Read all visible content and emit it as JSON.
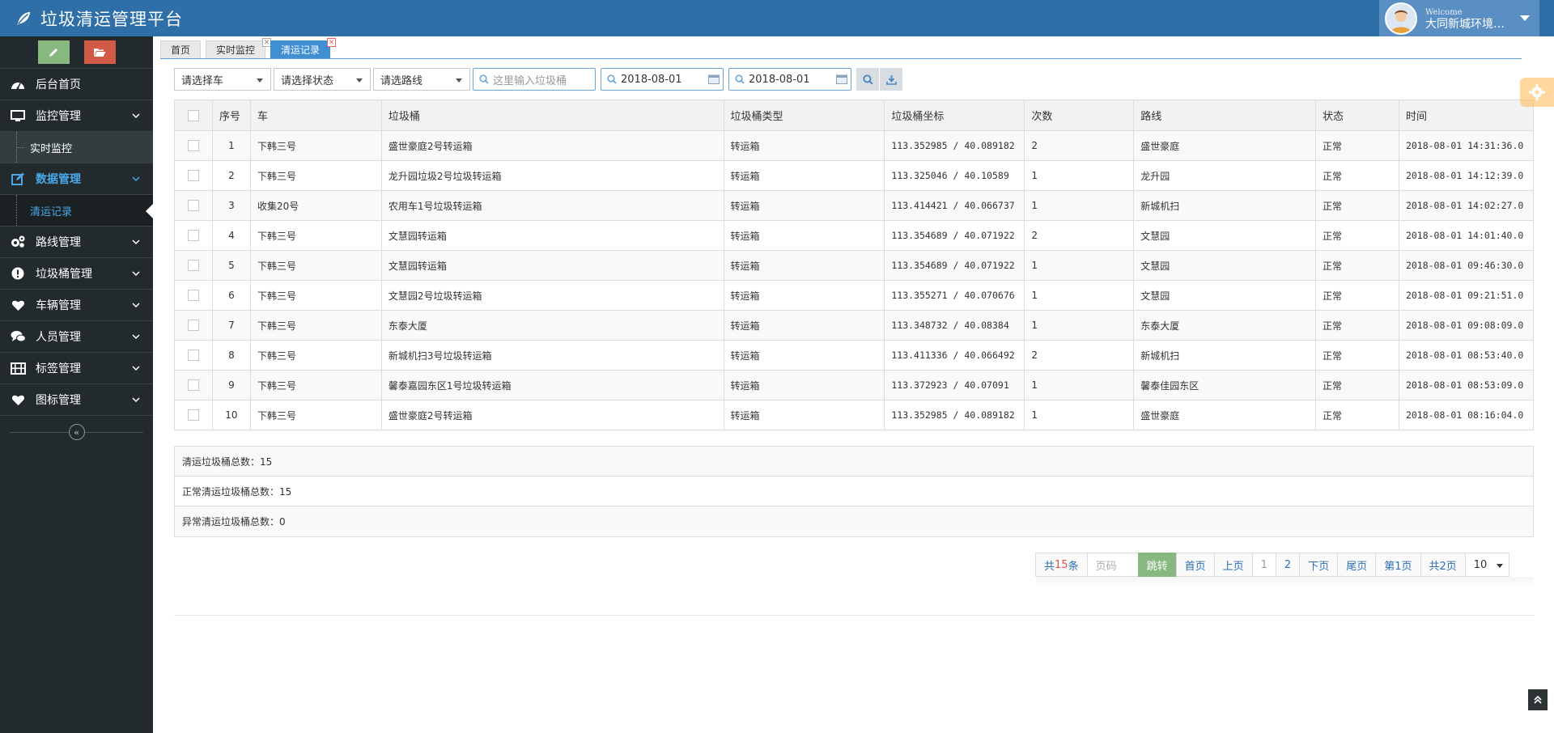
{
  "app": {
    "title": "垃圾清运管理平台",
    "welcome": "Welcome",
    "user": "大同新城环境…",
    "accent": "#2e6fa7"
  },
  "sidebar": {
    "items": [
      {
        "label": "后台首页",
        "icon": "dashboard-icon"
      },
      {
        "label": "监控管理",
        "icon": "desktop-icon"
      },
      {
        "label": "实时监控",
        "icon": ""
      },
      {
        "label": "数据管理",
        "icon": "edit-icon"
      },
      {
        "label": "清运记录",
        "icon": ""
      },
      {
        "label": "路线管理",
        "icon": "cogs-icon"
      },
      {
        "label": "垃圾桶管理",
        "icon": "exclamation-icon"
      },
      {
        "label": "车辆管理",
        "icon": "heart-icon"
      },
      {
        "label": "人员管理",
        "icon": "comments-icon"
      },
      {
        "label": "标签管理",
        "icon": "film-icon"
      },
      {
        "label": "图标管理",
        "icon": "heart-icon"
      }
    ],
    "collapse": "«"
  },
  "tabs": [
    {
      "label": "首页"
    },
    {
      "label": "实时监控"
    },
    {
      "label": "清运记录"
    }
  ],
  "filters": {
    "vehicle": "请选择车",
    "status": "请选择状态",
    "route": "请选路线",
    "bin_placeholder": "这里输入垃圾桶",
    "date_from": "2018-08-01",
    "date_to": "2018-08-01"
  },
  "table": {
    "headers": [
      "序号",
      "车",
      "垃圾桶",
      "垃圾桶类型",
      "垃圾桶坐标",
      "次数",
      "路线",
      "状态",
      "时间"
    ],
    "rows": [
      [
        "1",
        "下韩三号",
        "盛世豪庭2号转运箱",
        "转运箱",
        "113.352985  /  40.089182",
        "2",
        "盛世豪庭",
        "正常",
        "2018-08-01 14:31:36.0"
      ],
      [
        "2",
        "下韩三号",
        "龙升园垃圾2号垃圾转运箱",
        "转运箱",
        "113.325046  /  40.10589",
        "1",
        "龙升园",
        "正常",
        "2018-08-01 14:12:39.0"
      ],
      [
        "3",
        "收集20号",
        "农用车1号垃圾转运箱",
        "转运箱",
        "113.414421  /  40.066737",
        "1",
        "新城机扫",
        "正常",
        "2018-08-01 14:02:27.0"
      ],
      [
        "4",
        "下韩三号",
        "文慧园转运箱",
        "转运箱",
        "113.354689  /  40.071922",
        "2",
        "文慧园",
        "正常",
        "2018-08-01 14:01:40.0"
      ],
      [
        "5",
        "下韩三号",
        "文慧园转运箱",
        "转运箱",
        "113.354689  /  40.071922",
        "1",
        "文慧园",
        "正常",
        "2018-08-01 09:46:30.0"
      ],
      [
        "6",
        "下韩三号",
        "文慧园2号垃圾转运箱",
        "转运箱",
        "113.355271  /  40.070676",
        "1",
        "文慧园",
        "正常",
        "2018-08-01 09:21:51.0"
      ],
      [
        "7",
        "下韩三号",
        "东泰大厦",
        "转运箱",
        "113.348732  /  40.08384",
        "1",
        "东泰大厦",
        "正常",
        "2018-08-01 09:08:09.0"
      ],
      [
        "8",
        "下韩三号",
        "新城机扫3号垃圾转运箱",
        "转运箱",
        "113.411336  /  40.066492",
        "2",
        "新城机扫",
        "正常",
        "2018-08-01 08:53:40.0"
      ],
      [
        "9",
        "下韩三号",
        "馨泰嘉园东区1号垃圾转运箱",
        "转运箱",
        "113.372923  /  40.07091",
        "1",
        "馨泰佳园东区",
        "正常",
        "2018-08-01 08:53:09.0"
      ],
      [
        "10",
        "下韩三号",
        "盛世豪庭2号转运箱",
        "转运箱",
        "113.352985  /  40.089182",
        "1",
        "盛世豪庭",
        "正常",
        "2018-08-01 08:16:04.0"
      ]
    ]
  },
  "summary": {
    "total": "清运垃圾桶总数：15",
    "normal": "正常清运垃圾桶总数：15",
    "abnormal": "异常清运垃圾桶总数：0"
  },
  "pagination": {
    "total_prefix": "共",
    "total_count": "15",
    "total_suffix": "条",
    "page_placeholder": "页码",
    "jump": "跳转",
    "first": "首页",
    "prev": "上页",
    "page1": "1",
    "page2": "2",
    "next": "下页",
    "last": "尾页",
    "current": "第1页",
    "pages": "共2页",
    "page_size": "10"
  }
}
